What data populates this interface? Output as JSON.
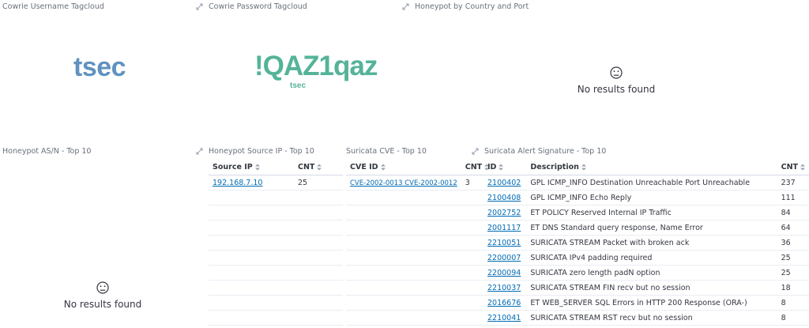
{
  "panels": {
    "username_tagcloud": {
      "title": "Cowrie Username Tagcloud",
      "tags": [
        "tsec"
      ]
    },
    "password_tagcloud": {
      "title": "Cowrie Password Tagcloud",
      "tags": [
        "!QAZ1qaz",
        "tsec"
      ]
    },
    "country_port": {
      "title": "Honeypot by Country and Port",
      "empty_text": "No results found"
    },
    "asn": {
      "title": "Honeypot AS/N - Top 10",
      "empty_text": "No results found"
    },
    "source_ip": {
      "title": "Honeypot Source IP - Top 10",
      "columns": [
        "Source IP",
        "CNT"
      ],
      "rows": [
        [
          "192.168.7.10",
          "25"
        ]
      ]
    },
    "suricata_cve": {
      "title": "Suricata CVE - Top 10",
      "columns": [
        "CVE ID",
        "CNT"
      ],
      "rows": [
        [
          "CVE-2002-0013 CVE-2002-0012",
          "3"
        ]
      ]
    },
    "alert_signature": {
      "title": "Suricata Alert Signature - Top 10",
      "columns": [
        "ID",
        "Description",
        "CNT"
      ],
      "rows": [
        [
          "2100402",
          "GPL ICMP_INFO Destination Unreachable Port Unreachable",
          "237"
        ],
        [
          "2100408",
          "GPL ICMP_INFO Echo Reply",
          "111"
        ],
        [
          "2002752",
          "ET POLICY Reserved Internal IP Traffic",
          "84"
        ],
        [
          "2001117",
          "ET DNS Standard query response, Name Error",
          "64"
        ],
        [
          "2210051",
          "SURICATA STREAM Packet with broken ack",
          "36"
        ],
        [
          "2200007",
          "SURICATA IPv4 padding required",
          "25"
        ],
        [
          "2200094",
          "SURICATA zero length padN option",
          "25"
        ],
        [
          "2210037",
          "SURICATA STREAM FIN recv but no session",
          "18"
        ],
        [
          "2016676",
          "ET WEB_SERVER SQL Errors in HTTP 200 Response (ORA-)",
          "8"
        ],
        [
          "2210041",
          "SURICATA STREAM RST recv but no session",
          "8"
        ]
      ]
    }
  },
  "colors": {
    "tag_username": "#6092c0",
    "tag_password": "#54b399",
    "link": "#006bb4"
  }
}
